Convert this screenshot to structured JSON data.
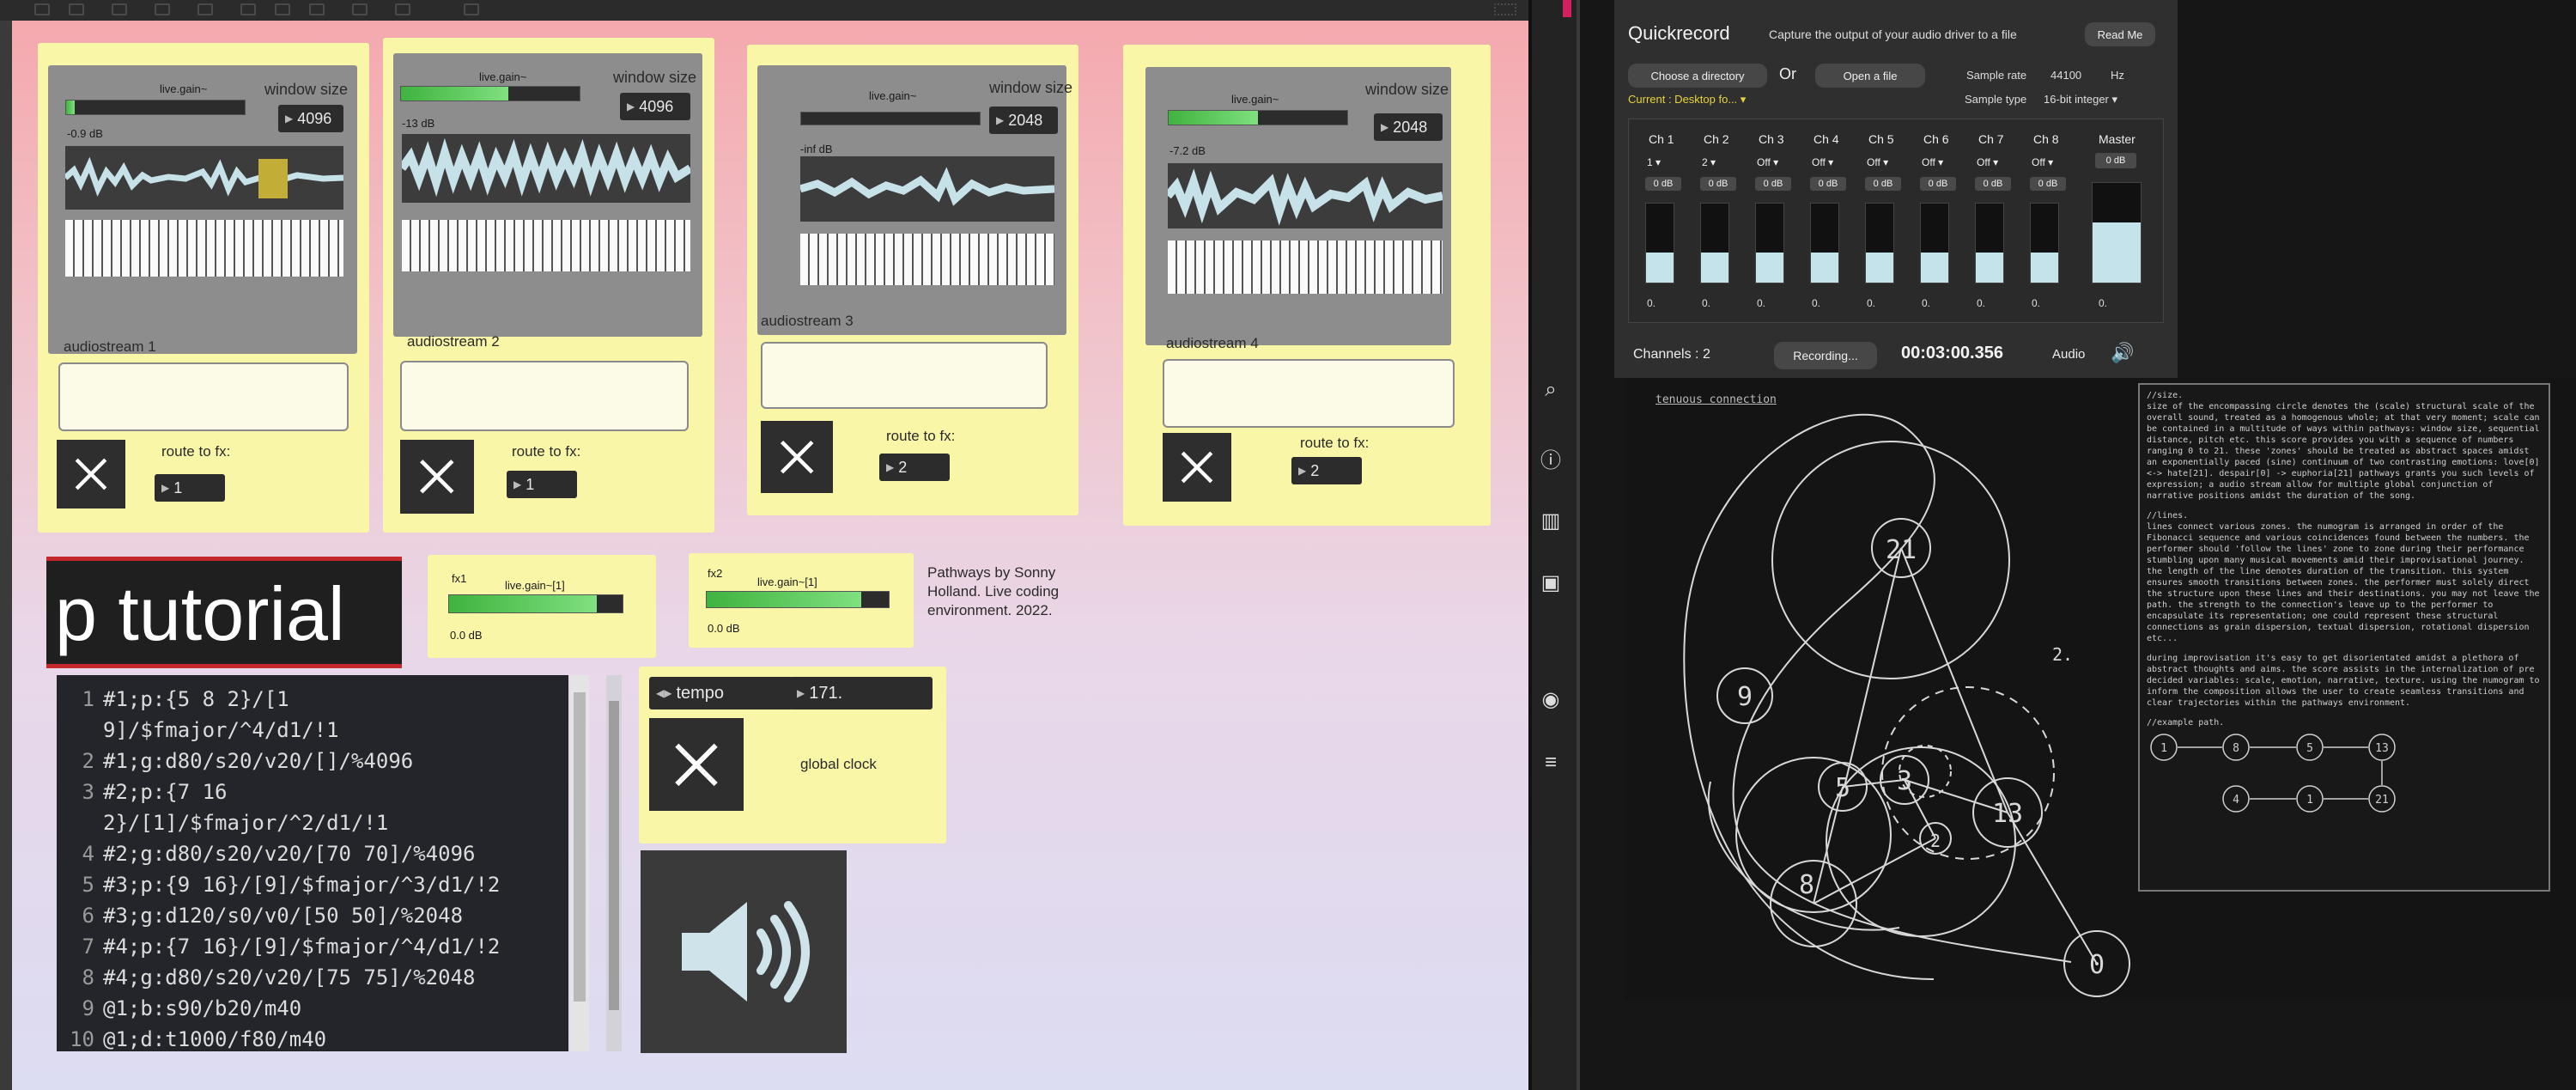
{
  "patcher": {
    "streams": [
      {
        "gain_label": "live.gain~",
        "window_label": "window size",
        "window_value": "4096",
        "db": "-0.9 dB",
        "title": "audiostream 1",
        "route_label": "route to fx:",
        "route_value": "1",
        "meter_level": 0.05
      },
      {
        "gain_label": "live.gain~",
        "window_label": "window size",
        "window_value": "4096",
        "db": "-13 dB",
        "title": "audiostream 2",
        "route_label": "route to fx:",
        "route_value": "1",
        "meter_level": 0.6
      },
      {
        "gain_label": "live.gain~",
        "window_label": "window size",
        "window_value": "2048",
        "db": "-inf dB",
        "title": "audiostream 3",
        "route_label": "route to fx:",
        "route_value": "2",
        "meter_level": 0.0
      },
      {
        "gain_label": "live.gain~",
        "window_label": "window size",
        "window_value": "2048",
        "db": "-7.2 dB",
        "title": "audiostream 4",
        "route_label": "route to fx:",
        "route_value": "2",
        "meter_level": 0.5
      }
    ],
    "tutorial_label": "p tutorial",
    "fx": [
      {
        "name": "fx1",
        "gain_label": "live.gain~[1]",
        "db": "0.0 dB",
        "meter_level": 0.85
      },
      {
        "name": "fx2",
        "gain_label": "live.gain~[1]",
        "db": "0.0 dB",
        "meter_level": 0.85
      }
    ],
    "credits": "Pathways by Sonny Holland. Live coding environment. 2022.",
    "tempo_label": "tempo",
    "tempo_value": "171.",
    "global_clock_label": "global clock",
    "code_lines": [
      {
        "n": "1",
        "t": "#1;p:{5 8 2}/[1"
      },
      {
        "n": "",
        "t": "9]/$fmajor/^4/d1/!1"
      },
      {
        "n": "2",
        "t": "#1;g:d80/s20/v20/[]/%4096"
      },
      {
        "n": "3",
        "t": "#2;p:{7 16"
      },
      {
        "n": "",
        "t": "2}/[1]/$fmajor/^2/d1/!1"
      },
      {
        "n": "4",
        "t": "#2;g:d80/s20/v20/[70 70]/%4096"
      },
      {
        "n": "5",
        "t": "#3;p:{9 16}/[9]/$fmajor/^3/d1/!2"
      },
      {
        "n": "6",
        "t": "#3;g:d120/s0/v0/[50 50]/%2048"
      },
      {
        "n": "7",
        "t": "#4;p:{7 16}/[9]/$fmajor/^4/d1/!2"
      },
      {
        "n": "8",
        "t": "#4;g:d80/s20/v20/[75 75]/%2048"
      },
      {
        "n": "9",
        "t": "@1;b:s90/b20/m40"
      },
      {
        "n": "10",
        "t": "@1;d:t1000/f80/m40"
      }
    ]
  },
  "quickrecord": {
    "title": "Quickrecord",
    "subtitle": "Capture the output of your audio driver to a file",
    "read_me": "Read Me",
    "choose_dir": "Choose a directory",
    "or": "Or",
    "open_file": "Open a file",
    "current": "Current : Desktop fo...",
    "sample_rate_label": "Sample rate",
    "sample_rate": "44100",
    "hz": "Hz",
    "sample_type_label": "Sample type",
    "sample_type": "16-bit integer",
    "channels": [
      {
        "name": "Ch 1",
        "sel": "1",
        "db": "0 dB",
        "level": 0.38
      },
      {
        "name": "Ch 2",
        "sel": "2",
        "db": "0 dB",
        "level": 0.38
      },
      {
        "name": "Ch 3",
        "sel": "Off",
        "db": "0 dB",
        "level": 0.38
      },
      {
        "name": "Ch 4",
        "sel": "Off",
        "db": "0 dB",
        "level": 0.38
      },
      {
        "name": "Ch 5",
        "sel": "Off",
        "db": "0 dB",
        "level": 0.38
      },
      {
        "name": "Ch 6",
        "sel": "Off",
        "db": "0 dB",
        "level": 0.38
      },
      {
        "name": "Ch 7",
        "sel": "Off",
        "db": "0 dB",
        "level": 0.38
      },
      {
        "name": "Ch 8",
        "sel": "Off",
        "db": "0 dB",
        "level": 0.38
      }
    ],
    "master_label": "Master",
    "master_db": "0 dB",
    "master_level": 0.6,
    "zero_label": "0.",
    "channels_label": "Channels : 2",
    "recording": "Recording...",
    "time": "00:03:00.356",
    "audio": "Audio"
  },
  "score": {
    "title": "tenuous connection",
    "nodes": [
      "21",
      "9",
      "5",
      "3",
      "2",
      "13",
      "8",
      "0"
    ],
    "marker": "2.",
    "legend_path": [
      "1",
      "8",
      "5",
      "13",
      "4",
      "1",
      "21"
    ],
    "text_paragraphs": [
      "//size.",
      "size of the encompassing circle denotes the (scale) structural scale of the overall sound, treated as a homogenous whole; at that very moment; scale can be contained in a multitude of ways within pathways: window size, sequential distance, pitch etc. this score provides you with a sequence of numbers ranging 0 to 21. these 'zones' should be treated as abstract spaces amidst an exponentially paced (sine) continuum of two contrasting emotions: love[0] <-> hate[21]. despair[0] -> euphoria[21] pathways grants you such levels of expression; a audio stream allow for multiple global conjunction of narrative positions amidst the duration of the song.",
      "//lines.",
      "lines connect various zones. the numogram is arranged in order of the Fibonacci sequence and various coincidences found between the numbers. the performer should 'follow the lines' zone to zone during their performance stumbling upon many musical movements amid their improvisational journey. the length of the line denotes duration of the transition. this system ensures smooth transitions between zones. the performer must solely direct the structure upon these lines and their destinations. you may not leave the path. the strength to the connection's leave up to the performer to encapsulate its representation; one could represent these structural connections as grain dispersion, textual dispersion, rotational dispersion etc...",
      "during improvisation it's easy to get disorientated amidst a plethora of abstract thoughts and aims. the score assists in the internalization of pre decided variables: scale, emotion, narrative, texture. using the numogram to inform the composition allows the user to create seamless transitions and clear trajectories within the pathways environment.",
      "//example path."
    ]
  }
}
